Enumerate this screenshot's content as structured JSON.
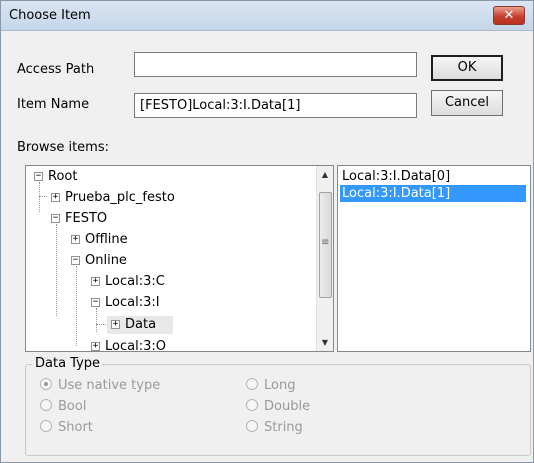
{
  "window": {
    "title": "Choose Item",
    "close_glyph": "✕"
  },
  "fields": {
    "access_path_label": "Access Path",
    "access_path_value": "",
    "item_name_label": "Item Name",
    "item_name_value": "[FESTO]Local:3:I.Data[1]"
  },
  "buttons": {
    "ok": "OK",
    "cancel": "Cancel"
  },
  "browse": {
    "label": "Browse items:",
    "tree": [
      {
        "label": "Root",
        "expander": "−"
      },
      {
        "label": "Prueba_plc_festo",
        "expander": "+"
      },
      {
        "label": "FESTO",
        "expander": "−"
      },
      {
        "label": "Offline",
        "expander": "+"
      },
      {
        "label": "Online",
        "expander": "−"
      },
      {
        "label": "Local:3:C",
        "expander": "+"
      },
      {
        "label": "Local:3:I",
        "expander": "−"
      },
      {
        "label": "Data",
        "expander": "+"
      },
      {
        "label": "Local:3:O",
        "expander": "+"
      }
    ],
    "items": [
      "Local:3:I.Data[0]",
      "Local:3:I.Data[1]"
    ],
    "selected_item": "Local:3:I.Data[1]"
  },
  "data_type": {
    "label": "Data Type",
    "options": [
      "Use native type",
      "Bool",
      "Short",
      "Long",
      "Double",
      "String"
    ],
    "selected": "Use native type",
    "enabled": false
  },
  "scroll_glyphs": {
    "up": "▲",
    "down": "▼",
    "grip": "≡"
  }
}
